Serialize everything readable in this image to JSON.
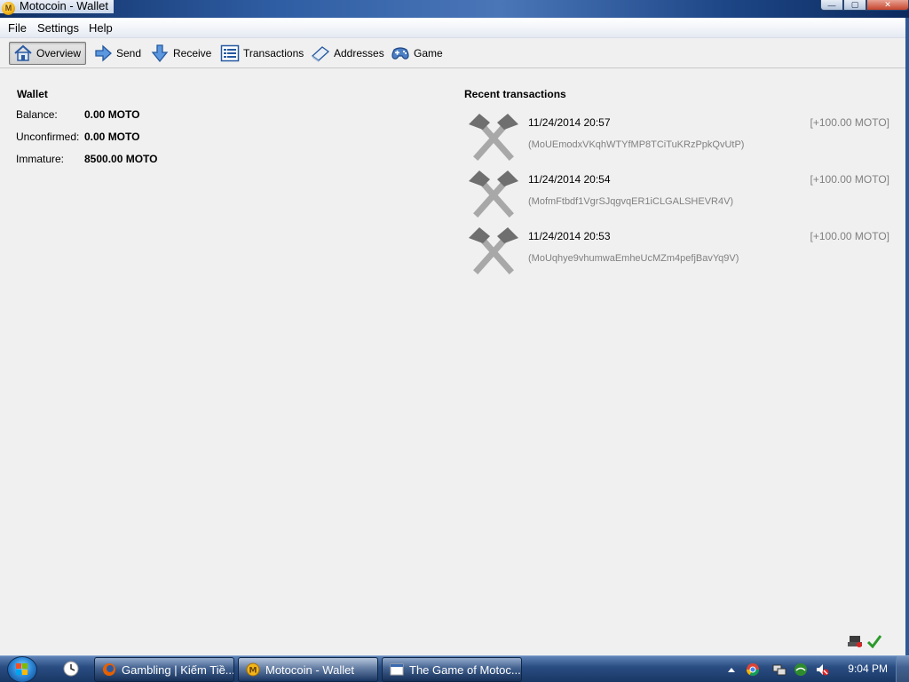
{
  "window": {
    "title": "Motocoin - Wallet",
    "icon_letter": "M",
    "controls": {
      "minimize": "—",
      "maximize": "▢",
      "close": "✕"
    }
  },
  "menu": [
    "File",
    "Settings",
    "Help"
  ],
  "toolbar": [
    {
      "label": "Overview",
      "icon": "home-icon",
      "active": true
    },
    {
      "label": "Send",
      "icon": "send-arrow-icon",
      "active": false
    },
    {
      "label": "Receive",
      "icon": "receive-arrow-icon",
      "active": false
    },
    {
      "label": "Transactions",
      "icon": "list-icon",
      "active": false
    },
    {
      "label": "Addresses",
      "icon": "address-book-icon",
      "active": false
    },
    {
      "label": "Game",
      "icon": "gamepad-icon",
      "active": false
    }
  ],
  "wallet": {
    "title": "Wallet",
    "balance_label": "Balance:",
    "balance_value": "0.00 MOTO",
    "unconfirmed_label": "Unconfirmed:",
    "unconfirmed_value": "0.00 MOTO",
    "immature_label": "Immature:",
    "immature_value": "8500.00 MOTO"
  },
  "recent": {
    "title": "Recent transactions",
    "items": [
      {
        "date": "11/24/2014 20:57",
        "amount": "[+100.00 MOTO]",
        "address": "(MoUEmodxVKqhWTYfMP8TCiTuKRzPpkQvUtP)",
        "icon": "mining-hammers-icon"
      },
      {
        "date": "11/24/2014 20:54",
        "amount": "[+100.00 MOTO]",
        "address": "(MofmFtbdf1VgrSJqgvqER1iCLGALSHEVR4V)",
        "icon": "mining-hammers-icon"
      },
      {
        "date": "11/24/2014 20:53",
        "amount": "[+100.00 MOTO]",
        "address": "(MoUqhye9vhumwaEmheUcMZm4pefjBavYq9V)",
        "icon": "mining-hammers-icon"
      }
    ]
  },
  "status": {
    "icons": [
      "network-icon",
      "synced-check-icon"
    ]
  },
  "taskbar": {
    "buttons": [
      {
        "label": "Gambling | Kiếm Tiề...",
        "icon": "firefox-icon",
        "active": false
      },
      {
        "label": "Motocoin - Wallet",
        "icon": "motocoin-icon",
        "active": true
      },
      {
        "label": "The Game of Motoc...",
        "icon": "window-icon",
        "active": false
      }
    ],
    "clock": "9:04 PM",
    "tray_icons": [
      "show-hidden-icon",
      "chrome-icon",
      "network-tray-icon",
      "shield-icon",
      "volume-muted-icon"
    ],
    "colors": {
      "active": "#ffffff"
    }
  }
}
